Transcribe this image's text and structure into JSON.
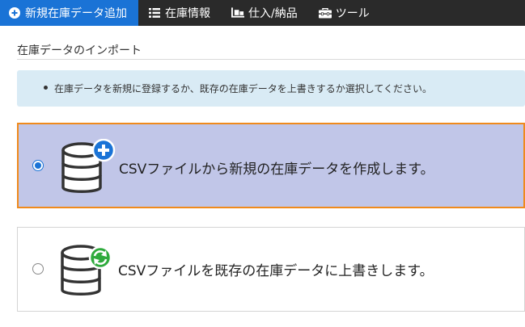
{
  "nav": {
    "tabs": [
      {
        "label": "新規在庫データ追加",
        "icon": "plus-circle-icon",
        "active": true
      },
      {
        "label": "在庫情報",
        "icon": "list-icon",
        "active": false
      },
      {
        "label": "仕入/納品",
        "icon": "truck-loading-icon",
        "active": false
      },
      {
        "label": "ツール",
        "icon": "toolbox-icon",
        "active": false
      }
    ]
  },
  "section": {
    "title": "在庫データのインポート"
  },
  "alert": {
    "message": "在庫データを新規に登録するか、既存の在庫データを上書きするか選択してください。"
  },
  "options": [
    {
      "label": "CSVファイルから新規の在庫データを作成します。",
      "selected": true,
      "badge_icon": "plus-badge-icon",
      "badge_color": "#1a73d6"
    },
    {
      "label": "CSVファイルを既存の在庫データに上書きします。",
      "selected": false,
      "badge_icon": "refresh-badge-icon",
      "badge_color": "#2eaa3c"
    }
  ],
  "colors": {
    "accent": "#1a73d6",
    "topbar": "#2a2a2a",
    "selected_bg": "#c1c6e8",
    "selected_border": "#f08a1c",
    "alert_bg": "#d9ebf5"
  }
}
